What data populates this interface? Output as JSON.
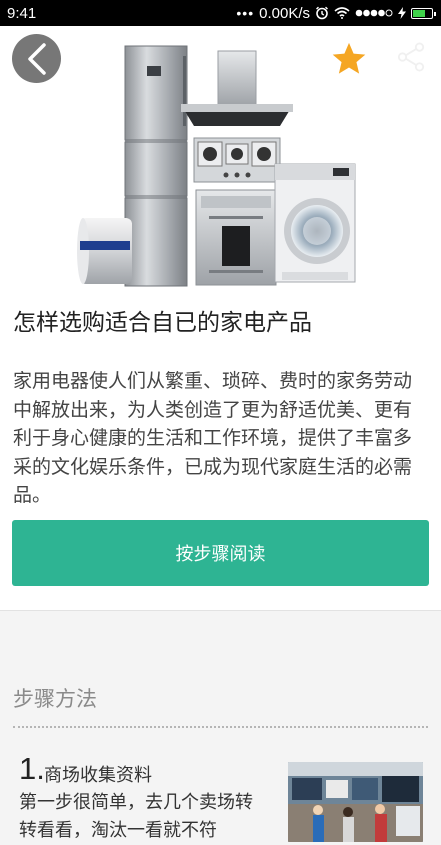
{
  "status_bar": {
    "time": "9:41",
    "network_speed": "0.00K/s",
    "icons": [
      "dots-icon",
      "alarm-icon",
      "wifi-icon",
      "signal-icon",
      "battery-icon"
    ]
  },
  "header": {
    "icons": [
      "back-arrow-icon",
      "star-icon",
      "share-icon"
    ],
    "star_color": "#f5a623"
  },
  "article": {
    "title": "怎样选购适合自已的家电产品",
    "description": "家用电器使人们从繁重、琐碎、费时的家务劳动中解放出来，为人类创造了更为舒适优美、更有利于身心健康的生活和工作环境，提供了丰富多采的文化娱乐条件，已成为现代家庭生活的必需品。",
    "read_button": "按步骤阅读",
    "accent_color": "#2eb493"
  },
  "steps": {
    "heading": "步骤方法",
    "items": [
      {
        "number": "1.",
        "title": "商场收集资料",
        "text": "第一步很简单，去几个卖场转转看看，淘汰一看就不符"
      }
    ]
  }
}
